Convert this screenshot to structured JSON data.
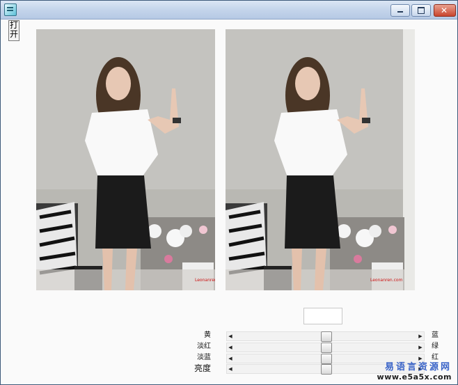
{
  "window": {
    "title": "",
    "buttons": {
      "minimize_icon": "minimize-icon",
      "maximize_icon": "maximize-icon",
      "close_icon": "close-icon"
    }
  },
  "toolbar": {
    "open_label": "打开"
  },
  "images": [
    {
      "name": "original-photo",
      "overlay_text": "Leonanren.com"
    },
    {
      "name": "adjusted-photo",
      "overlay_text": "Leonanren.com"
    }
  ],
  "value_box": {
    "value": ""
  },
  "sliders": [
    {
      "left_label": "黄",
      "right_label": "蓝",
      "position": 0.5
    },
    {
      "left_label": "淡红",
      "right_label": "绿",
      "position": 0.5
    },
    {
      "left_label": "淡蓝",
      "right_label": "红",
      "position": 0.5
    },
    {
      "left_label": "亮度",
      "right_label": "",
      "position": 0.5
    }
  ],
  "watermark": {
    "line1": "易语言资源网",
    "line2": "www.e5a5x.com"
  },
  "colors": {
    "title_bar": "#c2d3ea",
    "close_button": "#c9452e",
    "watermark_blue": "#3a64c8"
  }
}
